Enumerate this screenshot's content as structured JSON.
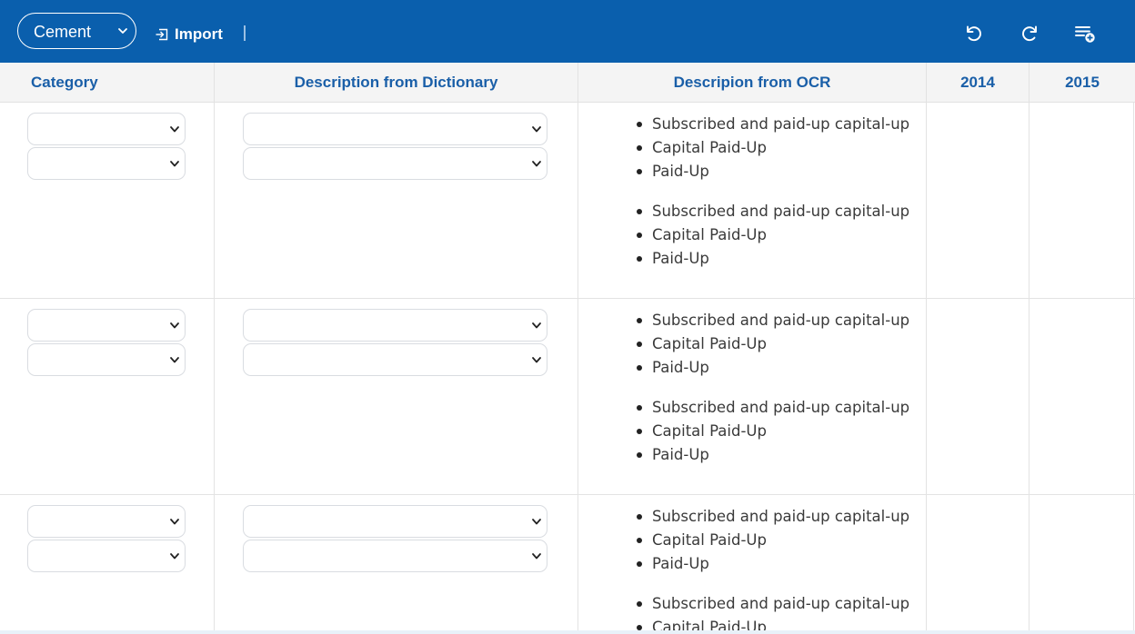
{
  "toolbar": {
    "industry_selected": "Cement",
    "import_label": "Import",
    "icons": [
      "undo-icon",
      "redo-icon",
      "add-list-icon"
    ],
    "background_color": "#0a5fad"
  },
  "table": {
    "headers": {
      "category": "Category",
      "dictionary": "Description from Dictionary",
      "ocr": "Descripion from OCR",
      "year1": "2014",
      "year2": "2015"
    },
    "header_text_color": "#1a5fa8",
    "rows": [
      {
        "ocr_group_a": [
          "Subscribed and paid-up capital-up",
          "Capital Paid-Up",
          "Paid-Up"
        ],
        "ocr_group_b": [
          "Subscribed and paid-up capital-up",
          "Capital Paid-Up",
          "Paid-Up"
        ]
      },
      {
        "ocr_group_a": [
          "Subscribed and paid-up capital-up",
          "Capital Paid-Up",
          "Paid-Up"
        ],
        "ocr_group_b": [
          "Subscribed and paid-up capital-up",
          "Capital Paid-Up",
          "Paid-Up"
        ]
      },
      {
        "ocr_group_a": [
          "Subscribed and paid-up capital-up",
          "Capital Paid-Up",
          "Paid-Up"
        ],
        "ocr_group_b": [
          "Subscribed and paid-up capital-up",
          "Capital Paid-Up"
        ]
      }
    ]
  }
}
